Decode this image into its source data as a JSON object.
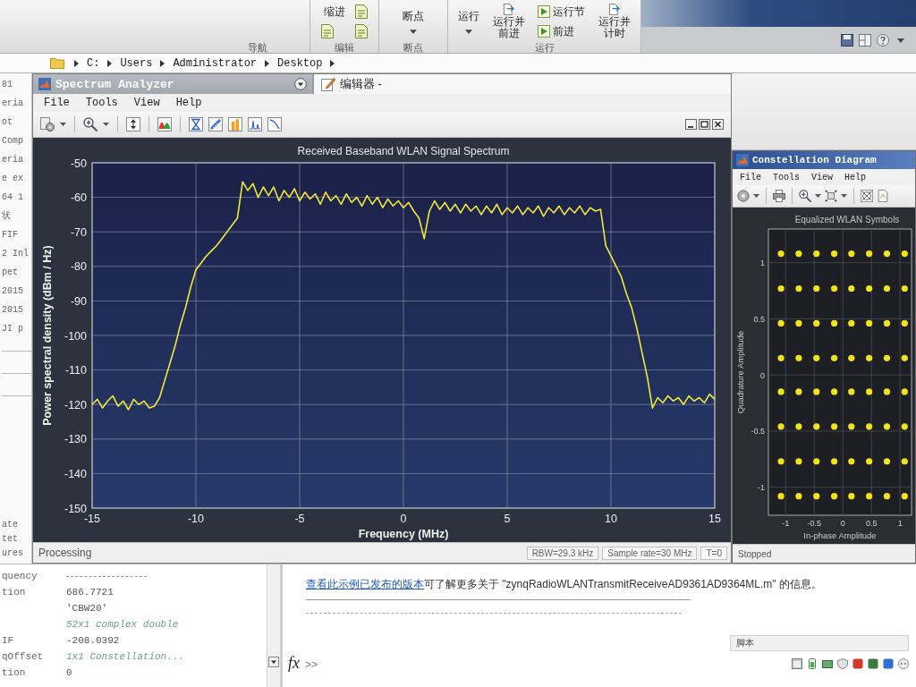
{
  "ribbon": {
    "groups": [
      {
        "label": "导航"
      },
      {
        "label": "编辑",
        "buttons": [
          {
            "kind": "text",
            "label": "缩进"
          },
          {
            "kind": "icon"
          },
          {
            "kind": "icon"
          },
          {
            "kind": "icon"
          }
        ]
      },
      {
        "label": "断点",
        "buttons": [
          {
            "kind": "menu",
            "label": "断点"
          }
        ]
      },
      {
        "label": "运行",
        "buttons": [
          {
            "kind": "menu",
            "label": "运行"
          },
          {
            "kind": "large",
            "label": "运行并前进"
          },
          {
            "kind": "small",
            "label": "运行节"
          },
          {
            "kind": "small",
            "label": "前进"
          },
          {
            "kind": "large",
            "label": "运行并计时"
          }
        ]
      }
    ]
  },
  "address_bar": {
    "path": [
      "C:",
      "Users",
      "Administrator",
      "Desktop"
    ]
  },
  "side_panel": {
    "fragments": [
      "81",
      "eria",
      "ot",
      "Comp",
      "eria",
      "e ex",
      "64 1",
      "状",
      "FIF",
      "2 Inl",
      "pet",
      "2015",
      "2015",
      "JI p"
    ],
    "lower": [
      "ate",
      "tet",
      "ures"
    ]
  },
  "spectrum_analyzer": {
    "title": "Spectrum Analyzer",
    "menu": [
      "File",
      "Tools",
      "View",
      "Help"
    ],
    "chart_data": {
      "type": "line",
      "title": "Received Baseband WLAN Signal Spectrum",
      "xlabel": "Frequency (MHz)",
      "ylabel": "Power spectral density (dBm / Hz)",
      "grid": true,
      "xlim": [
        -15,
        15
      ],
      "ylim": [
        -150,
        -50
      ],
      "xticks": [
        -15,
        -10,
        -5,
        0,
        5,
        10,
        15
      ],
      "yticks": [
        -50,
        -60,
        -70,
        -80,
        -90,
        -100,
        -110,
        -120,
        -130,
        -140,
        -150
      ],
      "x": [
        -15,
        -14.75,
        -14.5,
        -14.25,
        -14,
        -13.75,
        -13.5,
        -13.25,
        -13,
        -12.75,
        -12.5,
        -12.25,
        -12,
        -11.75,
        -11.5,
        -11.25,
        -11,
        -10.75,
        -10.5,
        -10.25,
        -10,
        -9.75,
        -9.5,
        -9.25,
        -9,
        -8.75,
        -8.5,
        -8.25,
        -8,
        -7.75,
        -7.5,
        -7.25,
        -7,
        -6.75,
        -6.5,
        -6.25,
        -6,
        -5.75,
        -5.5,
        -5.25,
        -5,
        -4.75,
        -4.5,
        -4.25,
        -4,
        -3.75,
        -3.5,
        -3.25,
        -3,
        -2.75,
        -2.5,
        -2.25,
        -2,
        -1.75,
        -1.5,
        -1.25,
        -1,
        -0.75,
        -0.5,
        -0.25,
        0,
        0.25,
        0.5,
        0.75,
        1,
        1.25,
        1.5,
        1.75,
        2,
        2.25,
        2.5,
        2.75,
        3,
        3.25,
        3.5,
        3.75,
        4,
        4.25,
        4.5,
        4.75,
        5,
        5.25,
        5.5,
        5.75,
        6,
        6.25,
        6.5,
        6.75,
        7,
        7.25,
        7.5,
        7.75,
        8,
        8.25,
        8.5,
        8.75,
        9,
        9.25,
        9.5,
        9.75,
        10,
        10.25,
        10.5,
        10.75,
        11,
        11.25,
        11.5,
        11.75,
        12,
        12.25,
        12.5,
        12.75,
        13,
        13.25,
        13.5,
        13.75,
        14,
        14.25,
        14.5,
        14.75,
        15
      ],
      "series": [
        {
          "color": "#f2e83a",
          "values": [
            -120,
            -118.5,
            -121,
            -119,
            -117.5,
            -120.5,
            -119,
            -121.5,
            -118.5,
            -120,
            -119,
            -121,
            -120.5,
            -118,
            -113,
            -108,
            -103,
            -97,
            -92,
            -86,
            -81,
            -79,
            -77,
            -75.5,
            -74,
            -72,
            -70,
            -68,
            -66,
            -55.5,
            -58,
            -56,
            -60,
            -57,
            -59.5,
            -57,
            -61,
            -58,
            -60,
            -57.5,
            -61,
            -58.5,
            -60.5,
            -59,
            -62,
            -58.5,
            -61,
            -59.5,
            -62,
            -59,
            -61.5,
            -60,
            -62.5,
            -59.5,
            -62,
            -60,
            -63,
            -60.5,
            -62.5,
            -61,
            -63,
            -61.5,
            -64,
            -66,
            -72,
            -64,
            -61,
            -63.5,
            -61.5,
            -64,
            -62,
            -64.5,
            -62,
            -64,
            -62.5,
            -65,
            -62.5,
            -64.5,
            -62,
            -65,
            -63,
            -64.5,
            -62.5,
            -65,
            -63,
            -64.5,
            -62.5,
            -65.5,
            -63,
            -64.5,
            -62.5,
            -65,
            -63,
            -64.5,
            -62.5,
            -65,
            -63,
            -64,
            -63.5,
            -74,
            -77,
            -80,
            -83,
            -88,
            -92,
            -98,
            -105,
            -112,
            -121,
            -118,
            -119.5,
            -117.5,
            -119,
            -118,
            -120,
            -117.5,
            -119,
            -118,
            -119.5,
            -117,
            -118.5
          ]
        }
      ]
    },
    "status": {
      "state": "Processing",
      "fields": [
        "RBW=29.3 kHz",
        "Sample rate=30 MHz",
        "T=0"
      ]
    }
  },
  "editor_tab": {
    "title": "编辑器 -"
  },
  "constellation_diagram": {
    "title": "Constellation Diagram",
    "menu": [
      "File",
      "Tools",
      "View",
      "Help"
    ],
    "chart_data": {
      "type": "scatter",
      "title": "Equalized WLAN Symbols",
      "xlabel": "In-phase Amplitude",
      "ylabel": "Quadrature Amplitude",
      "grid": true,
      "xlim": [
        -1.3,
        1.2
      ],
      "ylim": [
        -1.25,
        1.3
      ],
      "xticks": [
        -1,
        -0.5,
        0,
        0.5,
        1
      ],
      "yticks": [
        -1,
        -0.5,
        0,
        0.5,
        1
      ],
      "series": [
        {
          "color": "#f2e41c",
          "x": [
            -1.08,
            -0.77,
            -0.46,
            -0.15,
            0.15,
            0.46,
            0.77,
            1.08,
            -1.08,
            -0.77,
            -0.46,
            -0.15,
            0.15,
            0.46,
            0.77,
            1.08,
            -1.08,
            -0.77,
            -0.46,
            -0.15,
            0.15,
            0.46,
            0.77,
            1.08,
            -1.08,
            -0.77,
            -0.46,
            -0.15,
            0.15,
            0.46,
            0.77,
            1.08,
            -1.08,
            -0.77,
            -0.46,
            -0.15,
            0.15,
            0.46,
            0.77,
            1.08,
            -1.08,
            -0.77,
            -0.46,
            -0.15,
            0.15,
            0.46,
            0.77,
            1.08,
            -1.08,
            -0.77,
            -0.46,
            -0.15,
            0.15,
            0.46,
            0.77,
            1.08,
            -1.08,
            -0.77,
            -0.46,
            -0.15,
            0.15,
            0.46,
            0.77,
            1.08
          ],
          "values": [
            1.08,
            1.08,
            1.08,
            1.08,
            1.08,
            1.08,
            1.08,
            1.08,
            0.77,
            0.77,
            0.77,
            0.77,
            0.77,
            0.77,
            0.77,
            0.77,
            0.46,
            0.46,
            0.46,
            0.46,
            0.46,
            0.46,
            0.46,
            0.46,
            0.15,
            0.15,
            0.15,
            0.15,
            0.15,
            0.15,
            0.15,
            0.15,
            -0.15,
            -0.15,
            -0.15,
            -0.15,
            -0.15,
            -0.15,
            -0.15,
            -0.15,
            -0.46,
            -0.46,
            -0.46,
            -0.46,
            -0.46,
            -0.46,
            -0.46,
            -0.46,
            -0.77,
            -0.77,
            -0.77,
            -0.77,
            -0.77,
            -0.77,
            -0.77,
            -0.77,
            -1.08,
            -1.08,
            -1.08,
            -1.08,
            -1.08,
            -1.08,
            -1.08,
            -1.08
          ]
        }
      ]
    },
    "status": "Stopped"
  },
  "workspace": {
    "rows": [
      {
        "name": "quency"
      },
      {
        "name": "tion",
        "value": "686.7721",
        "kind": "value"
      },
      {
        "value": "'CBW20'",
        "kind": "value"
      },
      {
        "value": "52x1 complex double",
        "kind": "size"
      },
      {
        "name": "IF",
        "value": "-208.0392",
        "kind": "value"
      },
      {
        "name": "qOffset",
        "value": "1x1 Constellation...",
        "kind": "size"
      },
      {
        "name": "tion",
        "value": "0",
        "kind": "value"
      }
    ]
  },
  "command_window": {
    "link": "查看此示例已发布的版本",
    "message": "可了解更多关于 \"zynqRadioWLANTransmitReceiveAD9361AD9364ML.m\" 的信息。",
    "prompt_icon": "fx",
    "prompt": ">>"
  },
  "status_bar": {
    "mode": "脚本"
  }
}
